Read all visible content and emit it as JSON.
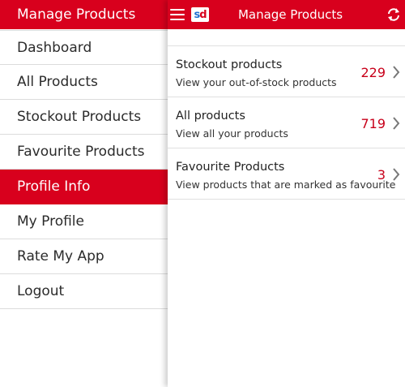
{
  "drawer": {
    "header": "Manage Products",
    "items": [
      {
        "label": "Dashboard",
        "type": "item"
      },
      {
        "label": "All Products",
        "type": "item"
      },
      {
        "label": "Stockout Products",
        "type": "item"
      },
      {
        "label": "Favourite Products",
        "type": "item"
      },
      {
        "label": "Profile Info",
        "type": "section"
      },
      {
        "label": "My Profile",
        "type": "item"
      },
      {
        "label": "Rate My App",
        "type": "item"
      },
      {
        "label": "Logout",
        "type": "item"
      }
    ]
  },
  "topbar": {
    "title": "Manage Products",
    "logo_s": "s",
    "logo_d": "d"
  },
  "products": [
    {
      "title": "Stockout products",
      "subtitle": "View your out-of-stock products",
      "count": "229"
    },
    {
      "title": "All products",
      "subtitle": "View all your products",
      "count": "719"
    },
    {
      "title": "Favourite Products",
      "subtitle": "View products that are marked as favourite",
      "count": "3"
    }
  ],
  "colors": {
    "accent": "#d8001d",
    "count": "#c8001a"
  }
}
